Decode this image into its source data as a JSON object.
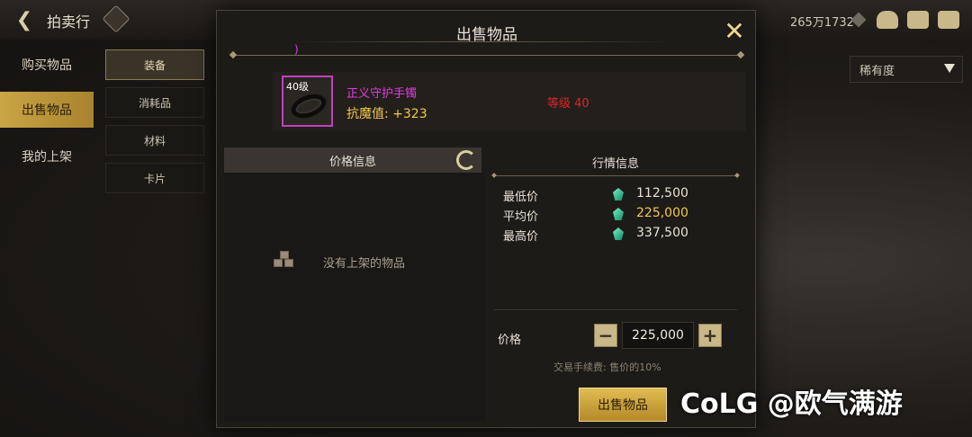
{
  "header": {
    "back_icon": "arrow-left-icon",
    "title": "拍卖行",
    "currency_amount": "265万1732",
    "icons": [
      "cake-icon",
      "mail-icon",
      "chat-icon"
    ]
  },
  "sidebar": {
    "items": [
      {
        "label": "购买物品"
      },
      {
        "label": "出售物品",
        "active": true
      },
      {
        "label": "我的上架"
      }
    ]
  },
  "subtabs": {
    "items": [
      {
        "label": "装备",
        "active": true
      },
      {
        "label": "消耗品"
      },
      {
        "label": "材料"
      },
      {
        "label": "卡片"
      }
    ]
  },
  "sort": {
    "value": "稀有度"
  },
  "modal": {
    "title": "出售物品",
    "pink_mark": ")",
    "item": {
      "level_badge": "40级",
      "name": "正义守护手镯",
      "stat": "抗魔值: +323",
      "requirement": "等级 40",
      "rarity_color": "#e23ae2"
    },
    "price_info": {
      "header": "价格信息",
      "empty_text": "没有上架的物品"
    },
    "market": {
      "title": "行情信息",
      "rows": [
        {
          "label": "最低价",
          "value": "112,500"
        },
        {
          "label": "平均价",
          "value": "225,000"
        },
        {
          "label": "最高价",
          "value": "337,500"
        }
      ]
    },
    "price": {
      "label": "价格",
      "value": "225,000",
      "fee_text": "交易手续费: 售价的10%"
    },
    "sell_button": "出售物品"
  },
  "watermark": "CoLG @欧气满游"
}
